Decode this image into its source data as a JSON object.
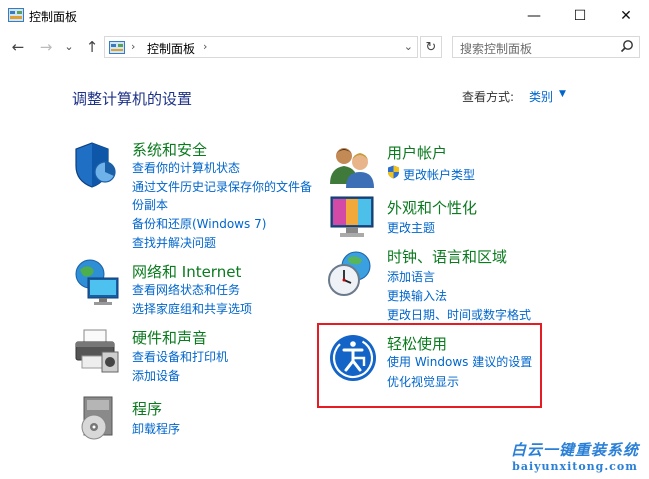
{
  "window": {
    "title": "控制面板",
    "minimize": "—",
    "maximize": "☐",
    "close": "✕"
  },
  "nav": {
    "back": "←",
    "forward": "→",
    "recent": "⌄",
    "up": "↑"
  },
  "address": {
    "path": "控制面板",
    "sep": "›",
    "dropdown": "⌄",
    "refresh": "↻"
  },
  "search": {
    "placeholder": "搜索控制面板"
  },
  "page": {
    "heading": "调整计算机的设置",
    "view_by_label": "查看方式:",
    "view_by_value": "类别",
    "view_by_arrow": "▼"
  },
  "categories": {
    "system": {
      "title": "系统和安全",
      "links": [
        "查看你的计算机状态",
        "通过文件历史记录保存你的文件备",
        "份副本",
        "备份和还原(Windows 7)",
        "查找并解决问题"
      ]
    },
    "network": {
      "title": "网络和 Internet",
      "links": [
        "查看网络状态和任务",
        "选择家庭组和共享选项"
      ]
    },
    "hardware": {
      "title": "硬件和声音",
      "links": [
        "查看设备和打印机",
        "添加设备"
      ]
    },
    "programs": {
      "title": "程序",
      "links": [
        "卸载程序"
      ]
    },
    "user": {
      "title": "用户帐户",
      "links": [
        "更改帐户类型"
      ]
    },
    "appearance": {
      "title": "外观和个性化",
      "links": [
        "更改主题"
      ]
    },
    "clock": {
      "title": "时钟、语言和区域",
      "links": [
        "添加语言",
        "更换输入法",
        "更改日期、时间或数字格式"
      ]
    },
    "ease": {
      "title": "轻松使用",
      "links": [
        "使用 Windows 建议的设置",
        "优化视觉显示"
      ]
    }
  },
  "watermark": {
    "line1": "白云一键重装系统",
    "line2": "baiyunxitong.com"
  },
  "colors": {
    "category_title": "#0a7a1e",
    "link": "#0066cc",
    "heading": "#1e3287",
    "highlight": "#e51c23"
  }
}
